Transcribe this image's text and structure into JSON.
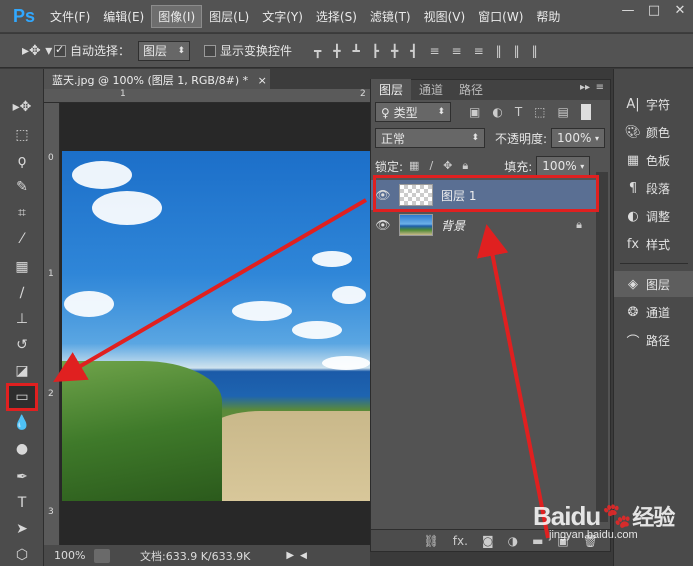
{
  "app": {
    "logo": "Ps"
  },
  "menu": [
    "文件(F)",
    "编辑(E)",
    "图像(I)",
    "图层(L)",
    "文字(Y)",
    "选择(S)",
    "滤镜(T)",
    "视图(V)",
    "窗口(W)",
    "帮助"
  ],
  "window_controls": [
    "—",
    "□",
    "✕"
  ],
  "options": {
    "auto_select_label": "自动选择：",
    "auto_select_value": "图层",
    "show_transform_label": "显示变换控件"
  },
  "document": {
    "tab_title": "蓝天.jpg @ 100% (图层 1, RGB/8#) *",
    "tab_close": "×",
    "zoom": "100%",
    "doc_info": "文档:633.9 K/633.9K",
    "ruler_h": [
      "1",
      "2"
    ],
    "ruler_v": [
      "0",
      "1",
      "2",
      "3"
    ]
  },
  "layers_panel": {
    "tabs": [
      "图层",
      "通道",
      "路径"
    ],
    "filter_value": "♀ 类型",
    "blend_mode": "正常",
    "opacity_label": "不透明度:",
    "opacity_value": "100%",
    "lock_label": "锁定:",
    "fill_label": "填充:",
    "fill_value": "100%",
    "layers": [
      {
        "name": "图层 1",
        "active": true
      },
      {
        "name": "背景",
        "active": false
      }
    ],
    "bottom_icons": [
      "link-icon",
      "fx-icon",
      "mask-icon",
      "adjustment-icon",
      "folder-icon",
      "new-layer-icon",
      "trash-icon"
    ],
    "fx_label": "fx."
  },
  "dock": {
    "items": [
      "字符",
      "颜色",
      "色板",
      "段落",
      "调整",
      "样式",
      "图层",
      "通道",
      "路径"
    ]
  },
  "watermark": {
    "brand": "Baidu",
    "brand_cn": "经验",
    "sub": "jingyan.baidu.com"
  },
  "colors": {
    "annotation": "#e02020",
    "active_layer": "#5a6f93",
    "ps_blue": "#31a8ff"
  }
}
